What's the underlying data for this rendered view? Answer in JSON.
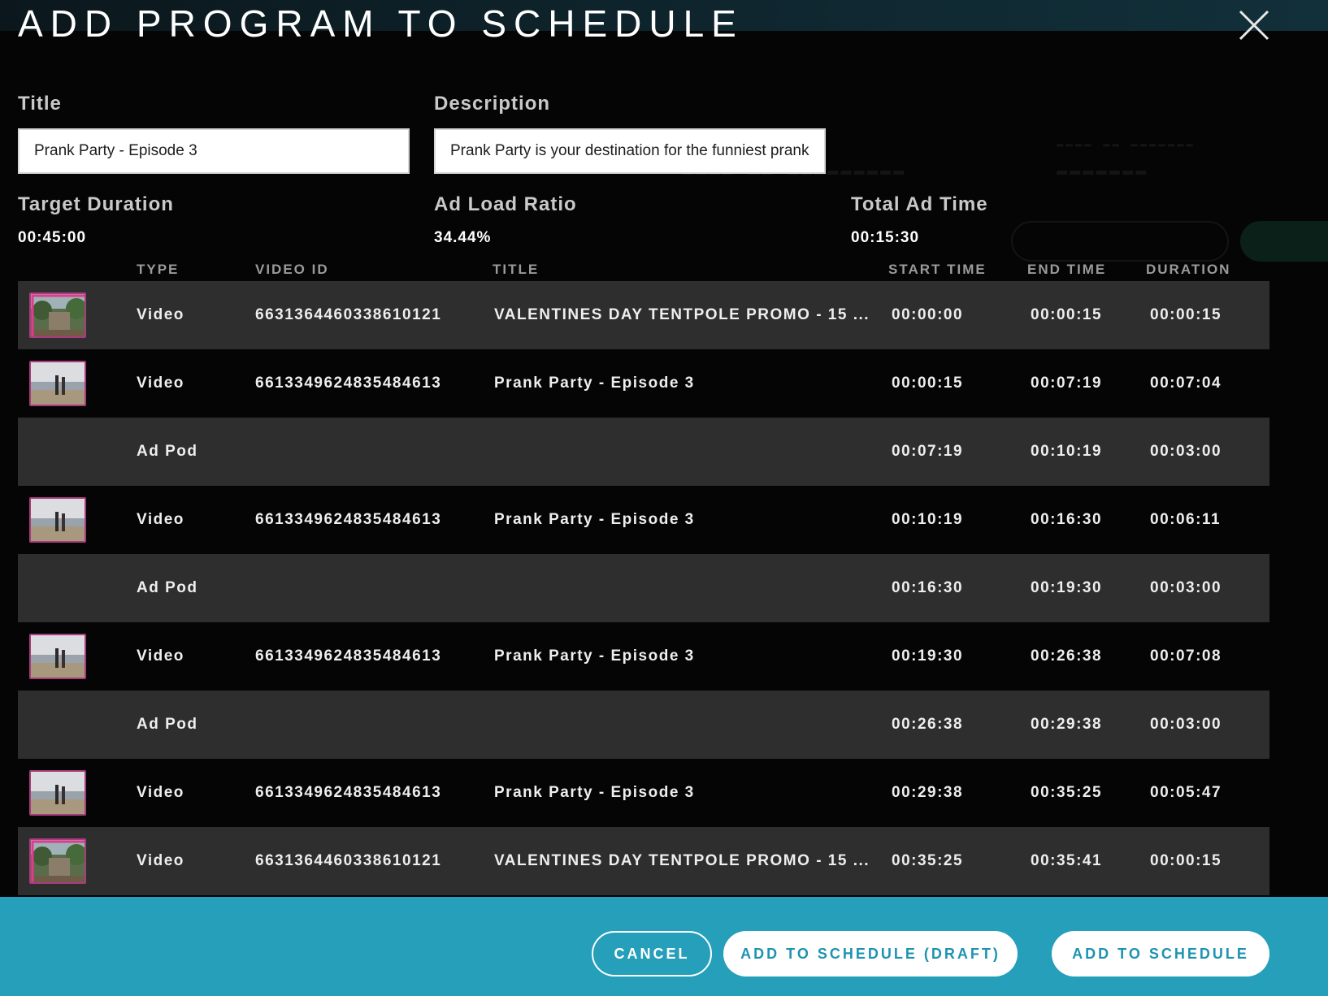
{
  "modal": {
    "title": "ADD PROGRAM TO SCHEDULE",
    "close_icon": "close-icon"
  },
  "form": {
    "title_label": "Title",
    "title_value": "Prank Party - Episode 3",
    "description_label": "Description",
    "description_value": "Prank Party is your destination for the funniest pranks"
  },
  "stats": {
    "target_duration_label": "Target Duration",
    "target_duration_value": "00:45:00",
    "ad_load_ratio_label": "Ad Load Ratio",
    "ad_load_ratio_value": "34.44%",
    "total_ad_time_label": "Total Ad Time",
    "total_ad_time_value": "00:15:30"
  },
  "table": {
    "headers": {
      "type": "TYPE",
      "video_id": "VIDEO ID",
      "title": "TITLE",
      "start_time": "START TIME",
      "end_time": "END TIME",
      "duration": "DURATION"
    },
    "rows": [
      {
        "thumb": "promo",
        "type": "Video",
        "video_id": "6631364460338610121",
        "title": "VALENTINES DAY TENTPOLE PROMO - 15 ...",
        "start": "00:00:00",
        "end": "00:00:15",
        "duration": "00:00:15"
      },
      {
        "thumb": "beach",
        "type": "Video",
        "video_id": "6613349624835484613",
        "title": "Prank Party - Episode 3",
        "start": "00:00:15",
        "end": "00:07:19",
        "duration": "00:07:04"
      },
      {
        "thumb": "",
        "type": "Ad Pod",
        "video_id": "",
        "title": "",
        "start": "00:07:19",
        "end": "00:10:19",
        "duration": "00:03:00"
      },
      {
        "thumb": "beach",
        "type": "Video",
        "video_id": "6613349624835484613",
        "title": "Prank Party - Episode 3",
        "start": "00:10:19",
        "end": "00:16:30",
        "duration": "00:06:11"
      },
      {
        "thumb": "",
        "type": "Ad Pod",
        "video_id": "",
        "title": "",
        "start": "00:16:30",
        "end": "00:19:30",
        "duration": "00:03:00"
      },
      {
        "thumb": "beach",
        "type": "Video",
        "video_id": "6613349624835484613",
        "title": "Prank Party - Episode 3",
        "start": "00:19:30",
        "end": "00:26:38",
        "duration": "00:07:08"
      },
      {
        "thumb": "",
        "type": "Ad Pod",
        "video_id": "",
        "title": "",
        "start": "00:26:38",
        "end": "00:29:38",
        "duration": "00:03:00"
      },
      {
        "thumb": "beach",
        "type": "Video",
        "video_id": "6613349624835484613",
        "title": "Prank Party - Episode 3",
        "start": "00:29:38",
        "end": "00:35:25",
        "duration": "00:05:47"
      },
      {
        "thumb": "promo",
        "type": "Video",
        "video_id": "6631364460338610121",
        "title": "VALENTINES DAY TENTPOLE PROMO - 15 ...",
        "start": "00:35:25",
        "end": "00:35:41",
        "duration": "00:00:15"
      }
    ]
  },
  "footer": {
    "cancel_label": "CANCEL",
    "draft_label": "ADD TO SCHEDULE (DRAFT)",
    "add_label": "ADD TO SCHEDULE"
  },
  "colors": {
    "footer": "#259fba",
    "button_text": "#1e93b0",
    "row_shade": "#2e2e2e",
    "thumb_border": "#a83c7c"
  }
}
